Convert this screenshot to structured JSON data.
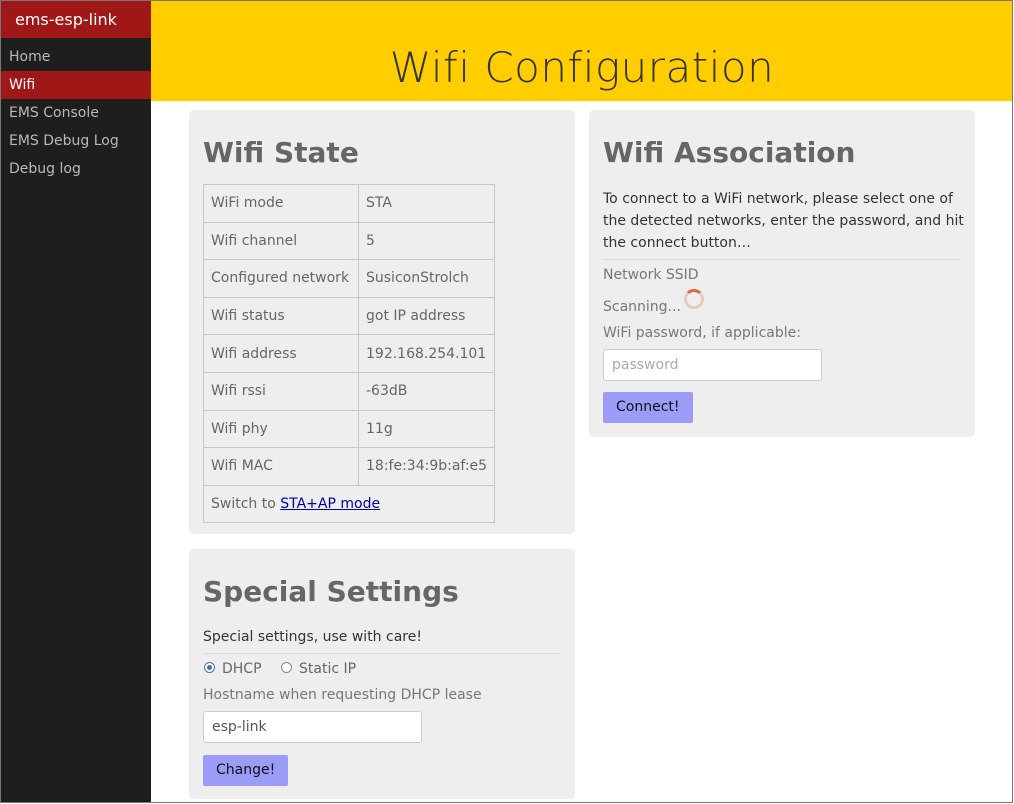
{
  "sidebar": {
    "brand": "ems-esp-link",
    "items": [
      {
        "label": "Home"
      },
      {
        "label": "Wifi"
      },
      {
        "label": "EMS Console"
      },
      {
        "label": "EMS Debug Log"
      },
      {
        "label": "Debug log"
      }
    ],
    "active": "Wifi"
  },
  "header": {
    "title": "Wifi Configuration"
  },
  "wifi_state": {
    "title": "Wifi State",
    "rows": [
      {
        "key": "WiFi mode",
        "value": "STA"
      },
      {
        "key": "Wifi channel",
        "value": "5"
      },
      {
        "key": "Configured network",
        "value": "SusiconStrolch"
      },
      {
        "key": "Wifi status",
        "value": "got IP address"
      },
      {
        "key": "Wifi address",
        "value": "192.168.254.101"
      },
      {
        "key": "Wifi rssi",
        "value": "-63dB"
      },
      {
        "key": "Wifi phy",
        "value": "11g"
      },
      {
        "key": "Wifi MAC",
        "value": "18:fe:34:9b:af:e5"
      }
    ],
    "switch_prefix": "Switch to ",
    "switch_link": "STA+AP mode"
  },
  "wifi_association": {
    "title": "Wifi Association",
    "description": "To connect to a WiFi network, please select one of the detected networks, enter the password, and hit the connect button…",
    "ssid_label": "Network SSID",
    "scanning_text": "Scanning...",
    "password_label": "WiFi password, if applicable:",
    "password_placeholder": "password",
    "password_value": "",
    "connect_button": "Connect!"
  },
  "special_settings": {
    "title": "Special Settings",
    "description": "Special settings, use with care!",
    "radio_dhcp": "DHCP",
    "radio_static": "Static IP",
    "selected": "DHCP",
    "hostname_label": "Hostname when requesting DHCP lease",
    "hostname_value": "esp-link",
    "change_button": "Change!"
  },
  "colors": {
    "brand_red": "#a01717",
    "header_yellow": "#ffcd00",
    "sidebar_bg": "#1e1e1e",
    "card_bg": "#eeeeee",
    "button_bg": "#9b9bf8"
  }
}
